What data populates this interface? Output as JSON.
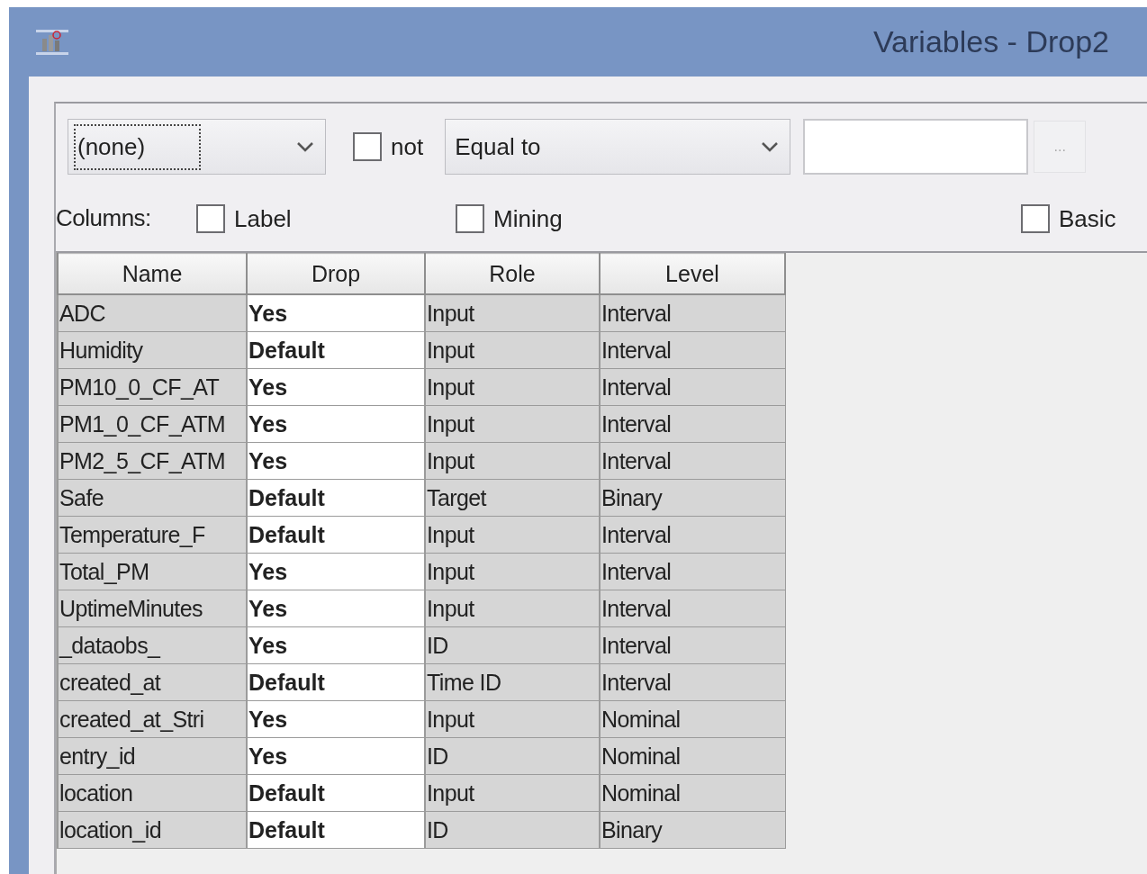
{
  "window": {
    "title": "Variables - Drop2"
  },
  "filter": {
    "field": "(none)",
    "not_checkbox": {
      "label": "not",
      "checked": false
    },
    "operator": "Equal to",
    "browse_button": "..."
  },
  "columns_options": {
    "label": "Columns:",
    "checkboxes": [
      {
        "label": "Label",
        "checked": false
      },
      {
        "label": "Mining",
        "checked": false
      },
      {
        "label": "Basic",
        "checked": false
      }
    ]
  },
  "table": {
    "columns": [
      "Name",
      "Drop",
      "Role",
      "Level"
    ],
    "rows": [
      {
        "name": "ADC",
        "drop": "Yes",
        "role": "Input",
        "level": "Interval"
      },
      {
        "name": "Humidity",
        "drop": "Default",
        "role": "Input",
        "level": "Interval"
      },
      {
        "name": "PM10_0_CF_AT",
        "drop": "Yes",
        "role": "Input",
        "level": "Interval"
      },
      {
        "name": "PM1_0_CF_ATM",
        "drop": "Yes",
        "role": "Input",
        "level": "Interval"
      },
      {
        "name": "PM2_5_CF_ATM",
        "drop": "Yes",
        "role": "Input",
        "level": "Interval"
      },
      {
        "name": "Safe",
        "drop": "Default",
        "role": "Target",
        "level": "Binary"
      },
      {
        "name": "Temperature_F",
        "drop": "Default",
        "role": "Input",
        "level": "Interval"
      },
      {
        "name": "Total_PM",
        "drop": "Yes",
        "role": "Input",
        "level": "Interval"
      },
      {
        "name": "UptimeMinutes",
        "drop": "Yes",
        "role": "Input",
        "level": "Interval"
      },
      {
        "name": "_dataobs_",
        "drop": "Yes",
        "role": "ID",
        "level": "Interval"
      },
      {
        "name": "created_at",
        "drop": "Default",
        "role": "Time ID",
        "level": "Interval"
      },
      {
        "name": "created_at_Stri",
        "drop": "Yes",
        "role": "Input",
        "level": "Nominal"
      },
      {
        "name": "entry_id",
        "drop": "Yes",
        "role": "ID",
        "level": "Nominal"
      },
      {
        "name": "location",
        "drop": "Default",
        "role": "Input",
        "level": "Nominal"
      },
      {
        "name": "location_id",
        "drop": "Default",
        "role": "ID",
        "level": "Binary"
      }
    ]
  }
}
